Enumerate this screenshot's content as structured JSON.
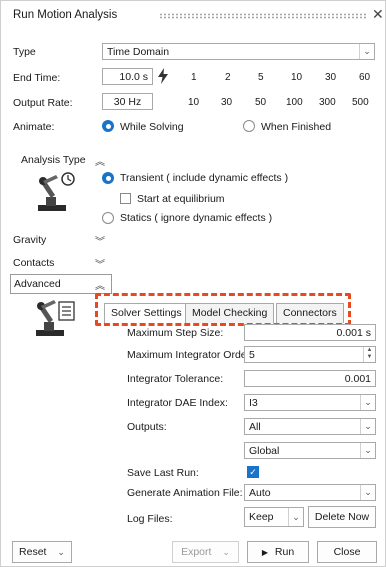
{
  "window": {
    "title": "Run Motion Analysis"
  },
  "type": {
    "label": "Type",
    "value": "Time Domain"
  },
  "end_time": {
    "label": "End Time:",
    "value": "10.0 s",
    "presets": [
      "1",
      "2",
      "5",
      "10",
      "30",
      "60"
    ]
  },
  "output_rate": {
    "label": "Output Rate:",
    "value": "30 Hz",
    "presets": [
      "10",
      "30",
      "50",
      "100",
      "300",
      "500"
    ]
  },
  "animate": {
    "label": "Animate:",
    "option1": "While Solving",
    "option2": "When Finished",
    "selected": "While Solving"
  },
  "sections": {
    "analysis_type": "Analysis Type",
    "gravity": "Gravity",
    "contacts": "Contacts",
    "advanced": "Advanced"
  },
  "analysis": {
    "transient": "Transient ( include dynamic effects )",
    "start_equilibrium": "Start at equilibrium",
    "statics": "Statics ( ignore dynamic effects )"
  },
  "tabs": [
    "Solver Settings",
    "Model Checking",
    "Connectors"
  ],
  "solver": {
    "max_step_label": "Maximum Step Size:",
    "max_step_value": "0.001 s",
    "max_order_label": "Maximum Integrator Order:",
    "max_order_value": "5",
    "tolerance_label": "Integrator Tolerance:",
    "tolerance_value": "0.001",
    "dae_label": "Integrator DAE Index:",
    "dae_value": "I3",
    "outputs_label": "Outputs:",
    "outputs_value": "All",
    "outputs_frame": "Global",
    "save_last_label": "Save Last Run:",
    "save_last_checked": true,
    "anim_file_label": "Generate Animation File:",
    "anim_file_value": "Auto",
    "log_label": "Log Files:",
    "log_value": "Keep",
    "delete_now": "Delete Now"
  },
  "footer": {
    "reset": "Reset",
    "export": "Export",
    "run": "Run",
    "close": "Close"
  },
  "colors": {
    "accent": "#1a73c8",
    "highlight": "#e84a1e"
  },
  "icons": [
    "lightning-icon",
    "robot-arm-timer-icon",
    "robot-arm-settings-icon",
    "run-play-icon"
  ]
}
